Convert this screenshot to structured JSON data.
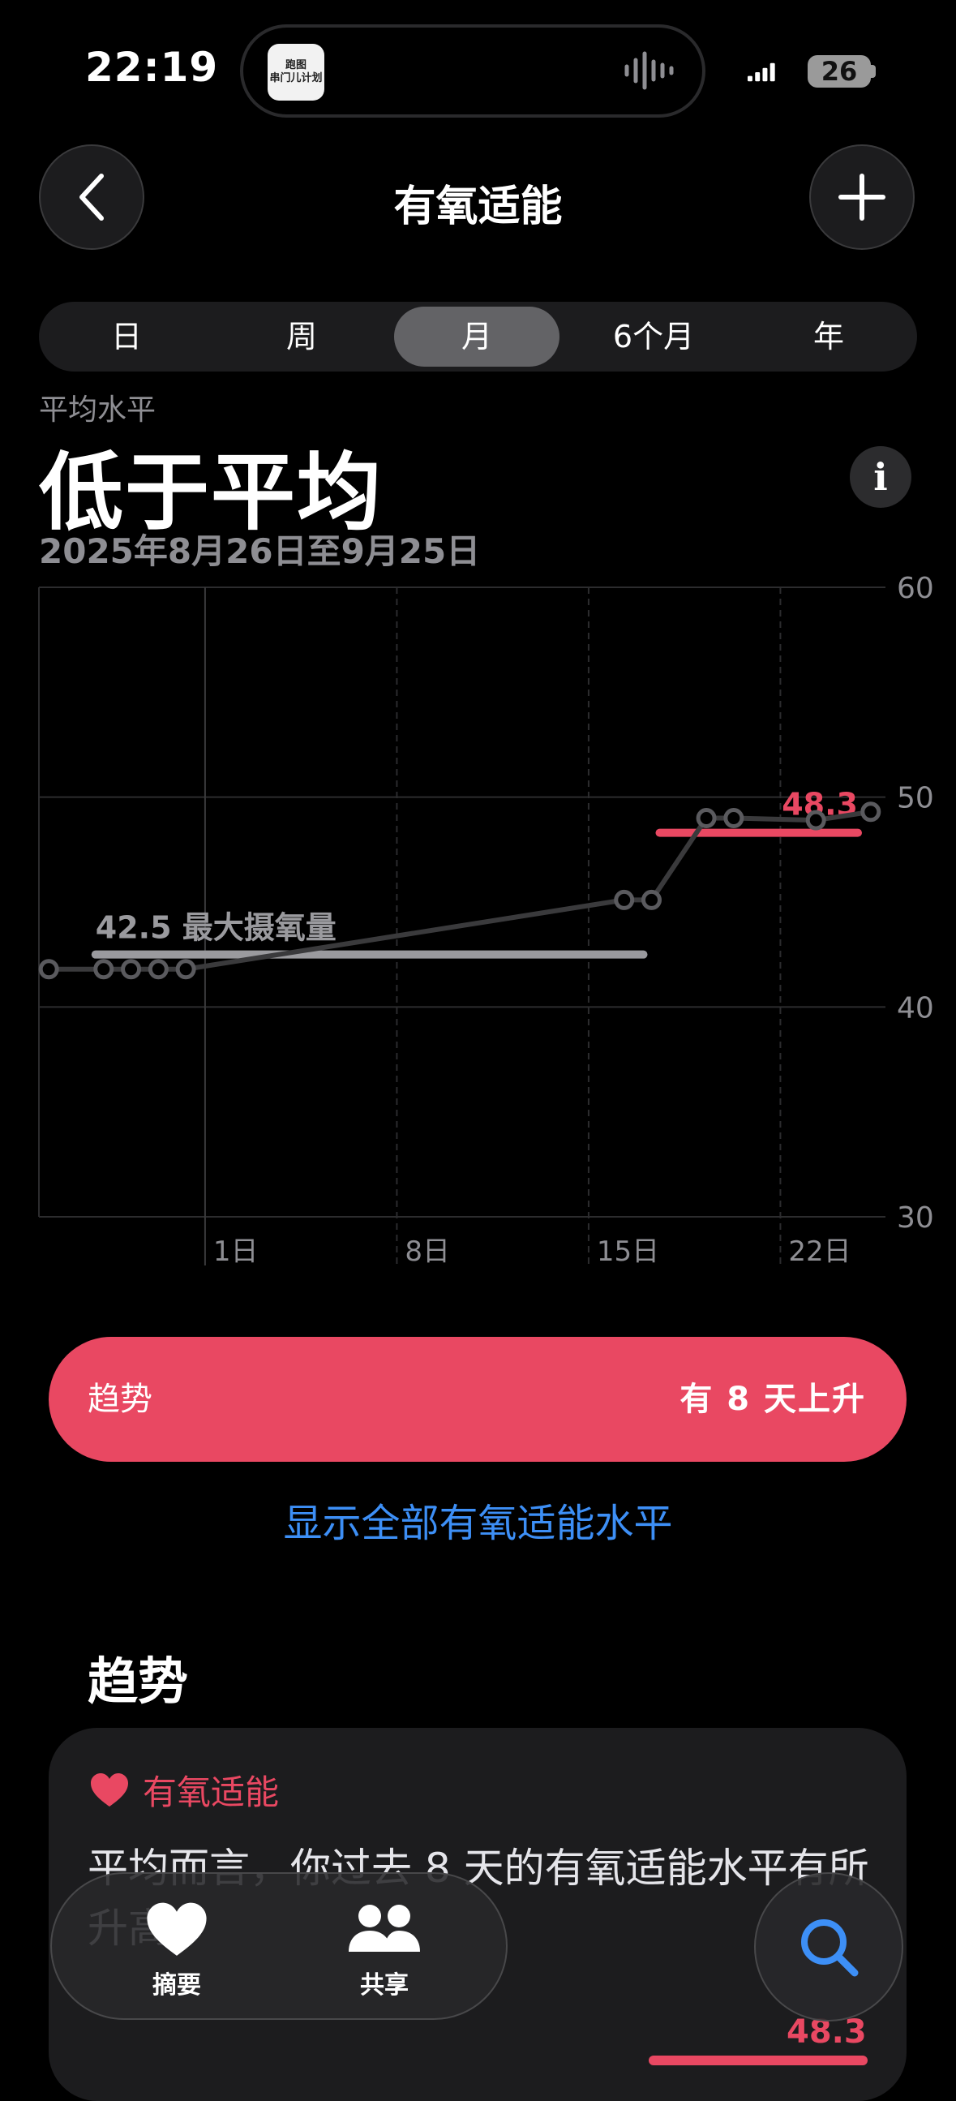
{
  "status_bar": {
    "time": "22:19",
    "battery": "26",
    "island_app": "跑图\n串门儿计划"
  },
  "nav": {
    "title": "有氧适能"
  },
  "segments": [
    "日",
    "周",
    "月",
    "6个月",
    "年"
  ],
  "selected_segment": "月",
  "summary": {
    "label": "平均水平",
    "headline": "低于平均",
    "date_range": "2025年8月26日至9月25日"
  },
  "chart_data": {
    "type": "line",
    "x_tick_labels": [
      "1日",
      "8日",
      "15日",
      "22日"
    ],
    "y_tick_labels": [
      "60",
      "50",
      "40",
      "30"
    ],
    "ylim": [
      30,
      60
    ],
    "x_domain_days": [
      "8月26日",
      "9月25日"
    ],
    "series": [
      {
        "x": [
          "8月26日",
          "8月28日",
          "8月29日",
          "8月30日",
          "8月31日",
          "9月16日",
          "9月17日",
          "9月19日",
          "9月20日",
          "9月23日",
          "9月25日"
        ],
        "values": [
          41.8,
          41.8,
          41.8,
          41.8,
          41.8,
          45.1,
          45.1,
          49.0,
          49.0,
          48.9,
          49.3
        ]
      }
    ],
    "reference_lines": [
      {
        "label": "42.5 最大摄氧量",
        "value": 42.5,
        "from": "8月28日",
        "to": "9月17日",
        "color": "#9a9a9e"
      },
      {
        "label": "48.3",
        "value": 48.3,
        "from": "9月17日",
        "to": "9月25日",
        "color": "#e94862"
      }
    ],
    "grid": true
  },
  "trend": {
    "label": "趋势",
    "value": "有 8 天上升"
  },
  "show_all_link": "显示全部有氧适能水平",
  "trends_section": {
    "title": "趋势",
    "card_title": "有氧适能",
    "card_text": "平均而言，你过去 8 天的有氧适能水平有所升高。",
    "card_value": "48.3"
  },
  "tabbar": {
    "summary_label": "摘要",
    "sharing_label": "共享"
  },
  "colors": {
    "accent": "#e94862",
    "link": "#3d8ff6",
    "background": "#000000"
  }
}
